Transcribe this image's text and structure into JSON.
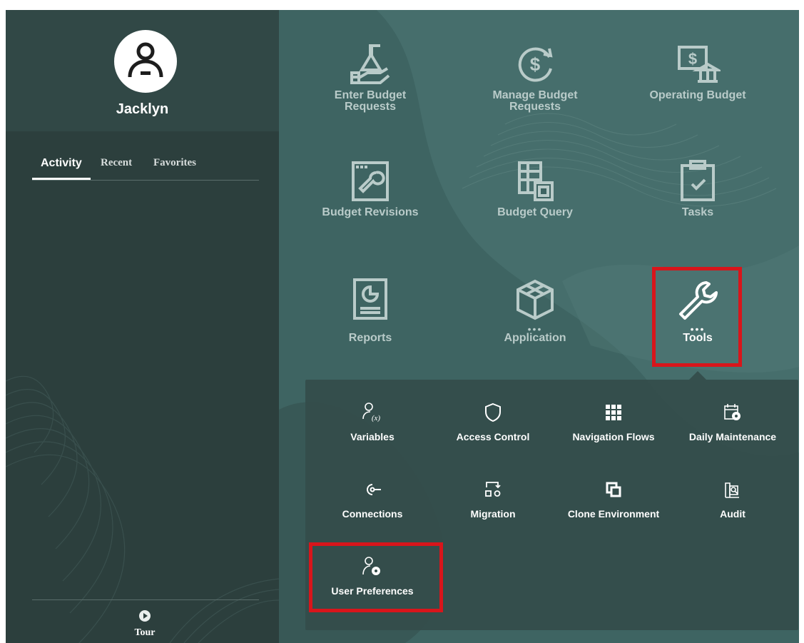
{
  "user": {
    "name": "Jacklyn"
  },
  "tabs": [
    "Activity",
    "Recent",
    "Favorites"
  ],
  "tour_label": "Tour",
  "tiles": [
    {
      "label_line1": "Enter Budget",
      "label_line2": "Requests",
      "icon": "flask-hand-icon"
    },
    {
      "label_line1": "Manage Budget",
      "label_line2": "Requests",
      "icon": "dollar-cycle-icon"
    },
    {
      "label_line1": "Operating Budget",
      "label_line2": "",
      "icon": "money-bank-icon"
    },
    {
      "label_line1": "Budget Revisions",
      "label_line2": "",
      "icon": "wrench-document-icon"
    },
    {
      "label_line1": "Budget Query",
      "label_line2": "",
      "icon": "grid-query-icon"
    },
    {
      "label_line1": "Tasks",
      "label_line2": "",
      "icon": "clipboard-check-icon"
    },
    {
      "label_line1": "Reports",
      "label_line2": "",
      "icon": "report-chart-icon"
    },
    {
      "label_line1": "Application",
      "label_line2": "",
      "icon": "cube-icon"
    },
    {
      "label_line1": "Tools",
      "label_line2": "",
      "icon": "wrench-icon"
    }
  ],
  "submenu": [
    {
      "label": "Variables",
      "icon": "user-variable-icon"
    },
    {
      "label": "Access Control",
      "icon": "shield-icon"
    },
    {
      "label": "Navigation Flows",
      "icon": "grid-flow-icon"
    },
    {
      "label": "Daily Maintenance",
      "icon": "calendar-gear-icon"
    },
    {
      "label": "Connections",
      "icon": "connection-icon"
    },
    {
      "label": "Migration",
      "icon": "migration-icon"
    },
    {
      "label": "Clone Environment",
      "icon": "clone-icon"
    },
    {
      "label": "Audit",
      "icon": "audit-icon"
    },
    {
      "label": "User Preferences",
      "icon": "user-gear-icon"
    }
  ],
  "colors": {
    "accent_highlight": "#d8151b",
    "panel": "#2c3f3d",
    "background": "#3e6462"
  }
}
